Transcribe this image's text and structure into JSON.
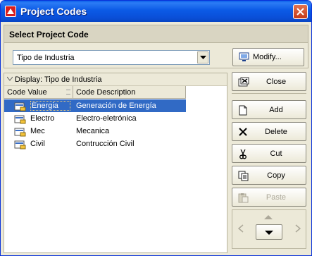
{
  "window": {
    "title": "Project Codes"
  },
  "header": {
    "title": "Select Project Code",
    "select_value": "Tipo de Industria",
    "modify_label": "Modify..."
  },
  "list": {
    "group_label": "Display: Tipo de Industria",
    "columns": {
      "value": "Code Value",
      "description": "Code Description"
    },
    "rows": [
      {
        "value": "Energia",
        "description": "Generación de Energía",
        "selected": true
      },
      {
        "value": "Electro",
        "description": "Electro-eletrónica",
        "selected": false
      },
      {
        "value": "Mec",
        "description": "Mecanica",
        "selected": false
      },
      {
        "value": "Civil",
        "description": "Contrucción Civil",
        "selected": false
      }
    ]
  },
  "buttons": {
    "close": "Close",
    "add": "Add",
    "delete": "Delete",
    "cut": "Cut",
    "copy": "Copy",
    "paste": "Paste"
  },
  "colors": {
    "titlebar": "#0a5fe9",
    "selection": "#316ac5",
    "window_bg": "#ece9d8"
  },
  "icons": {
    "app": "primavera-app-icon",
    "close": "close-x-icon",
    "row": "code-folder-icon",
    "modify": "monitor-edit-icon",
    "close_button": "close-window-icon",
    "add": "new-document-icon",
    "delete": "delete-x-icon",
    "cut": "scissors-icon",
    "copy": "copy-icon",
    "paste": "paste-icon"
  }
}
